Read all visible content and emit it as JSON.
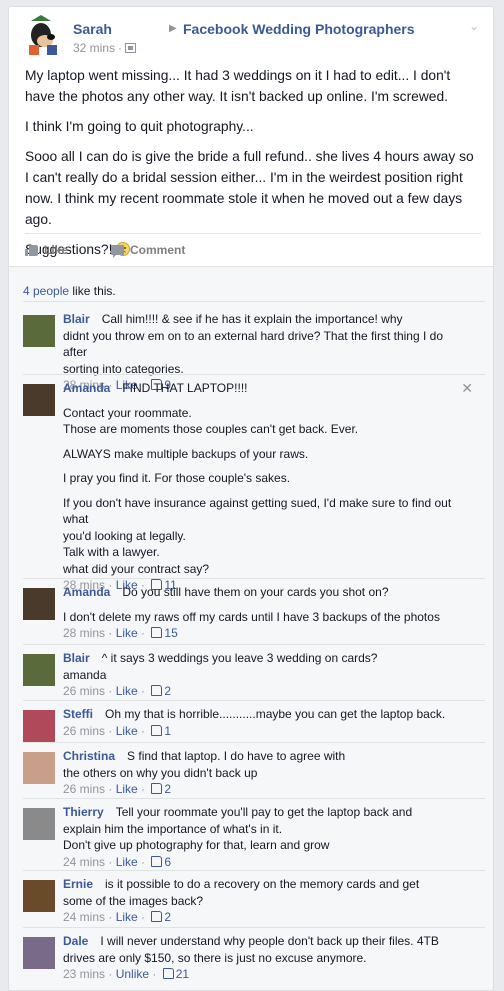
{
  "post": {
    "author": "Sarah",
    "group": "Facebook Wedding Photographers",
    "time": "32 mins",
    "paragraphs": [
      "My laptop went missing... It had 3 weddings on it I had to edit... I don't have the photos any other way. It isn't backed up online. I'm screwed.",
      "I think I'm going to quit photography...",
      "Sooo all I can do is give the bride a full refund.. she lives 4 hours away so I can't really do a bridal session either... I'm in the weirdest position right now. I think my recent roommate stole it when he moved out a few days ago.",
      "Suggestions?!"
    ]
  },
  "actions": {
    "like": "Like",
    "comment": "Comment"
  },
  "likes": {
    "count": "4 people",
    "suffix": "like this."
  },
  "comments": [
    {
      "name": "Blair",
      "lines": [
        "Call him!!!! & see if he has it explain the importance! why",
        "didnt you throw em on to an external hard drive? That the first thing I do after",
        "sorting into categories."
      ],
      "time": "28 mins",
      "like": "Like",
      "count": "9",
      "avatar": "#5a6a3a"
    },
    {
      "name": "Amanda",
      "lines": [
        "FIND THAT LAPTOP!!!!",
        "",
        "Contact your roommate.",
        "Those are moments those couples can't get back. Ever.",
        "",
        "ALWAYS make multiple backups of your raws.",
        "",
        "I pray you find it. For those couple's sakes.",
        "",
        "If you don't have insurance against getting sued, I'd make sure to find out what",
        "you'd looking at legally.",
        "Talk with a lawyer.",
        "what did your contract say?"
      ],
      "time": "28 mins",
      "like": "Like",
      "count": "11",
      "avatar": "#4a3a2a"
    },
    {
      "name": "Amanda",
      "lines": [
        "Do you still have them on your cards you shot on?",
        "",
        "I don't delete my raws off my cards until I have 3 backups of the photos"
      ],
      "time": "28 mins",
      "like": "Like",
      "count": "15",
      "avatar": "#4a3a2a"
    },
    {
      "name": "Blair",
      "lines": [
        "^ it says 3 weddings you leave 3 wedding on cards?",
        "amanda"
      ],
      "time": "26 mins",
      "like": "Like",
      "count": "2",
      "avatar": "#5a6a3a"
    },
    {
      "name": "Steffi",
      "lines": [
        "Oh my that is horrible...........maybe you can get the laptop back."
      ],
      "time": "26 mins",
      "like": "Like",
      "count": "1",
      "avatar": "#b04a5a"
    },
    {
      "name": "Christina",
      "lines": [
        "S          find that laptop. I do have to agree with",
        "the others on why you didn't back up"
      ],
      "time": "26 mins",
      "like": "Like",
      "count": "2",
      "avatar": "#c8a08a"
    },
    {
      "name": "Thierry",
      "lines": [
        "Tell your roommate you'll pay to get the laptop back and",
        "explain him the importance of what's in it.",
        "Don't give up photography for that, learn and grow"
      ],
      "time": "24 mins",
      "like": "Like",
      "count": "6",
      "avatar": "#8a8a8a"
    },
    {
      "name": "Ernie",
      "lines": [
        "is it possible to do a recovery on the memory cards and get",
        "some of the images back?"
      ],
      "time": "24 mins",
      "like": "Like",
      "count": "2",
      "avatar": "#6a4a2a"
    },
    {
      "name": "Dale",
      "lines": [
        "I will never understand why people don't back up their files. 4TB",
        "drives are only $150, so there is just no excuse anymore."
      ],
      "time": "23 mins",
      "like": "Unlike",
      "count": "21",
      "avatar": "#7a6a8a"
    }
  ]
}
